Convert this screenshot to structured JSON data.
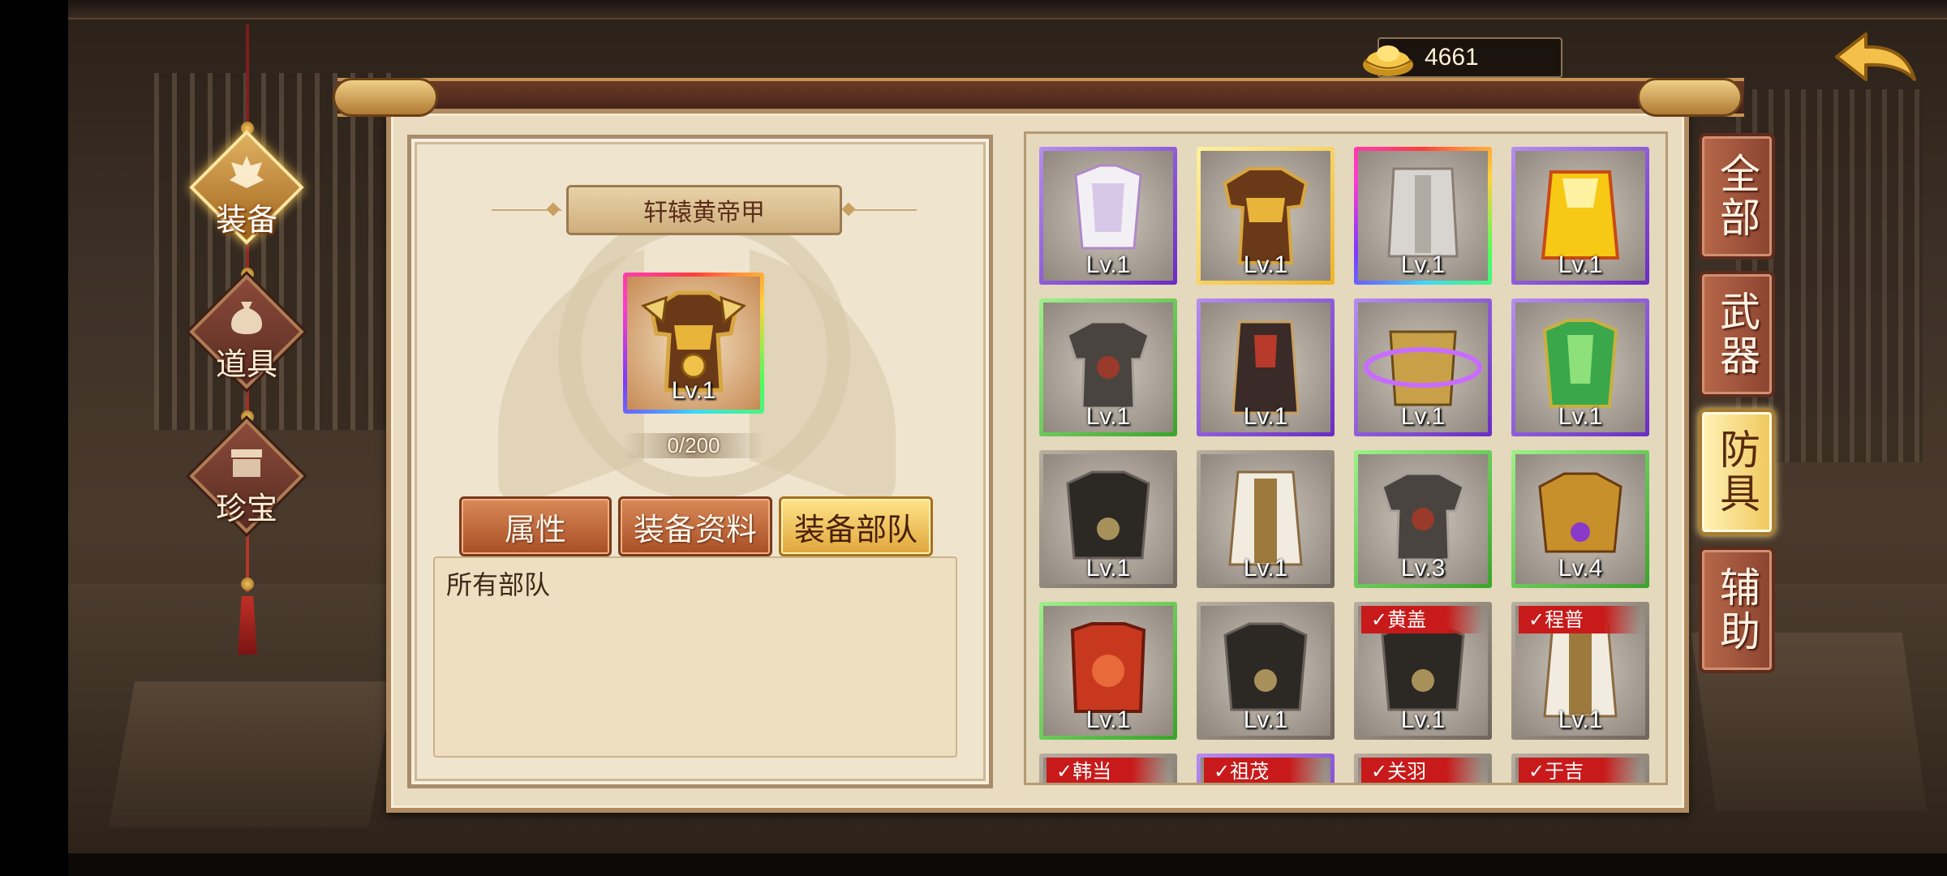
{
  "currency": {
    "icon": "gold-ingot-icon",
    "value": "4661"
  },
  "categories": [
    {
      "label": "装备",
      "icon": "equipment-icon",
      "active": true
    },
    {
      "label": "道具",
      "icon": "bag-icon",
      "active": false
    },
    {
      "label": "珍宝",
      "icon": "treasure-chest-icon",
      "active": false
    }
  ],
  "selected_item": {
    "name": "轩辕黄帝甲",
    "level": "Lv.1",
    "progress": "0/200"
  },
  "detail_tabs": [
    {
      "label": "属性",
      "active": false
    },
    {
      "label": "装备资料",
      "active": false
    },
    {
      "label": "装备部队",
      "active": true
    }
  ],
  "description": "所有部队",
  "filter_tabs": [
    {
      "label": "全部",
      "active": false
    },
    {
      "label": "武器",
      "active": false
    },
    {
      "label": "防具",
      "active": true
    },
    {
      "label": "辅助",
      "active": false
    }
  ],
  "items": [
    {
      "level": "Lv.1",
      "rarity": "purple",
      "badge": ""
    },
    {
      "level": "Lv.1",
      "rarity": "gold",
      "badge": ""
    },
    {
      "level": "Lv.1",
      "rarity": "rainbow",
      "badge": ""
    },
    {
      "level": "Lv.1",
      "rarity": "purple",
      "badge": ""
    },
    {
      "level": "Lv.1",
      "rarity": "green",
      "badge": ""
    },
    {
      "level": "Lv.1",
      "rarity": "purple",
      "badge": ""
    },
    {
      "level": "Lv.1",
      "rarity": "purple",
      "badge": ""
    },
    {
      "level": "Lv.1",
      "rarity": "purple",
      "badge": ""
    },
    {
      "level": "Lv.1",
      "rarity": "grey",
      "badge": ""
    },
    {
      "level": "Lv.1",
      "rarity": "grey",
      "badge": ""
    },
    {
      "level": "Lv.3",
      "rarity": "green",
      "badge": ""
    },
    {
      "level": "Lv.4",
      "rarity": "green",
      "badge": ""
    },
    {
      "level": "Lv.1",
      "rarity": "green",
      "badge": ""
    },
    {
      "level": "Lv.1",
      "rarity": "grey",
      "badge": ""
    },
    {
      "level": "Lv.1",
      "rarity": "grey",
      "badge": "✓黄盖"
    },
    {
      "level": "Lv.1",
      "rarity": "grey",
      "badge": "✓程普"
    },
    {
      "level": "",
      "rarity": "grey",
      "badge": "✓韩当"
    },
    {
      "level": "",
      "rarity": "purple",
      "badge": "✓祖茂"
    },
    {
      "level": "",
      "rarity": "grey",
      "badge": "✓关羽"
    },
    {
      "level": "",
      "rarity": "grey",
      "badge": "✓于吉"
    }
  ],
  "colors": {
    "frame": "#b08a60",
    "parchment": "#e9dcc0",
    "badge_red": "#c81a1a",
    "active_gold": "#f0c85c"
  }
}
